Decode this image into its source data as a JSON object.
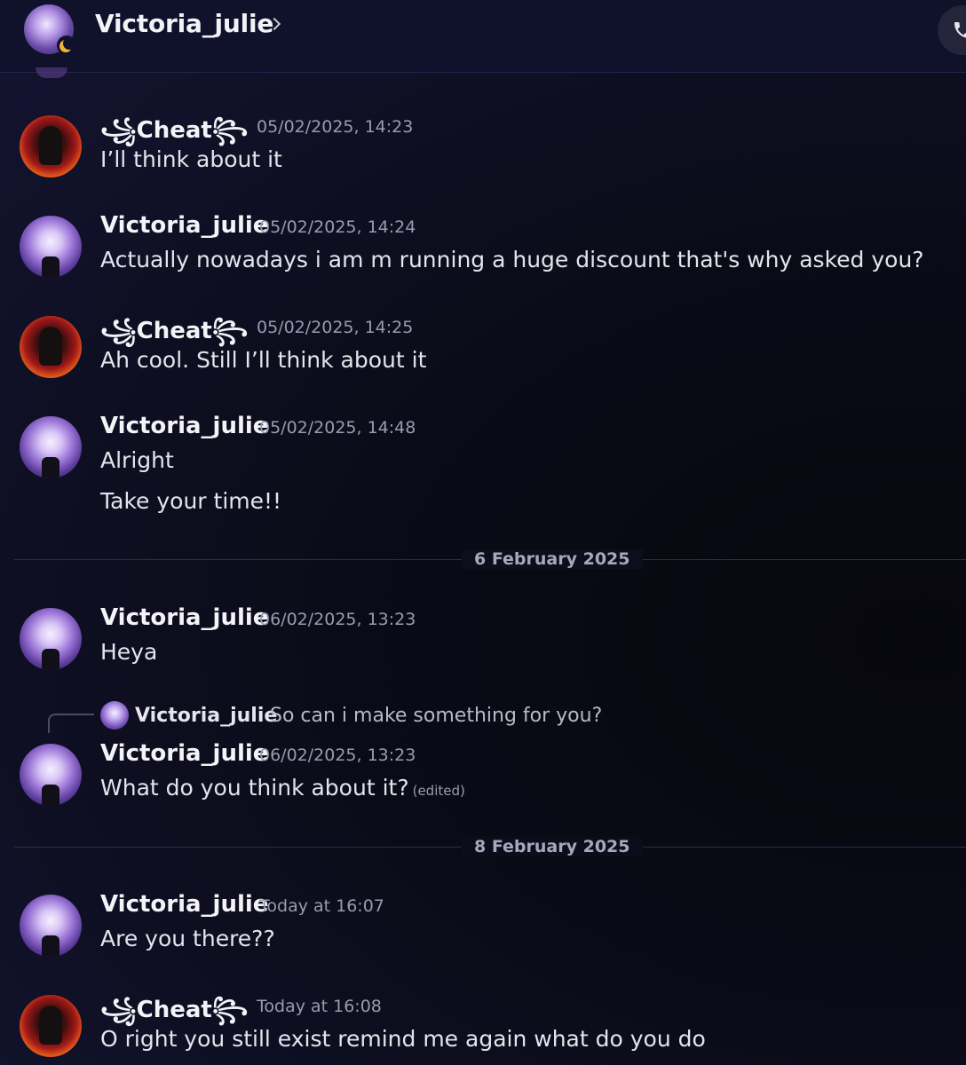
{
  "header": {
    "title": "Victoria_julie",
    "status": "idle"
  },
  "messages": [
    {
      "author": "꧁Cheat꧂",
      "time": "05/02/2025, 14:23",
      "lines": [
        "I’ll think about it"
      ]
    },
    {
      "author": "Victoria_julie",
      "time": "05/02/2025, 14:24",
      "lines": [
        "Actually nowadays i am m running a huge discount that's why asked you?"
      ]
    },
    {
      "author": "꧁Cheat꧂",
      "time": "05/02/2025, 14:25",
      "lines": [
        "Ah cool. Still I’ll think about it"
      ]
    },
    {
      "author": "Victoria_julie",
      "time": "05/02/2025, 14:48",
      "lines": [
        "Alright",
        "Take your time!!"
      ]
    },
    {
      "author": "Victoria_julie",
      "time": "06/02/2025, 13:23",
      "lines": [
        "Heya"
      ]
    },
    {
      "author": "Victoria_julie",
      "time": "06/02/2025, 13:23",
      "lines": [
        "What do you think about it?"
      ],
      "edited": "(edited)",
      "reply": {
        "author": "Victoria_julie",
        "text": "So can i make something for you?"
      }
    },
    {
      "author": "Victoria_julie",
      "time": "Today at 16:07",
      "lines": [
        "Are you there??"
      ]
    },
    {
      "author": "꧁Cheat꧂",
      "time": "Today at 16:08",
      "lines": [
        "O right you still exist remind me again what do you do"
      ]
    }
  ],
  "dividers": [
    "6 February 2025",
    "8 February 2025"
  ]
}
